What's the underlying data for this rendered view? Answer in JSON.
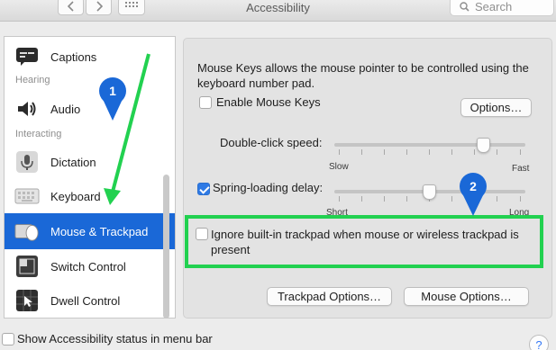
{
  "window": {
    "title": "Accessibility",
    "search_placeholder": "Search"
  },
  "sidebar": {
    "items": [
      {
        "label": "Captions",
        "icon": "captions-icon"
      },
      {
        "label": "Audio",
        "icon": "speaker-icon"
      },
      {
        "label": "Dictation",
        "icon": "microphone-icon"
      },
      {
        "label": "Keyboard",
        "icon": "keyboard-icon"
      },
      {
        "label": "Mouse & Trackpad",
        "icon": "mouse-trackpad-icon",
        "selected": true
      },
      {
        "label": "Switch Control",
        "icon": "switch-control-icon"
      },
      {
        "label": "Dwell Control",
        "icon": "dwell-control-icon"
      }
    ],
    "headings": [
      "Hearing",
      "Interacting"
    ]
  },
  "main": {
    "description": "Mouse Keys allows the mouse pointer to be controlled using the keyboard number pad.",
    "enable_mouse_keys": {
      "label": "Enable Mouse Keys",
      "checked": false
    },
    "options_button": "Options…",
    "double_click": {
      "label": "Double-click speed:",
      "min_label": "Slow",
      "max_label": "Fast",
      "value": 0.78
    },
    "spring_loading": {
      "label": "Spring-loading delay:",
      "checked": true,
      "min_label": "Short",
      "max_label": "Long",
      "value": 0.5
    },
    "ignore_trackpad": {
      "label": "Ignore built-in trackpad when mouse or wireless trackpad is present",
      "checked": false
    },
    "trackpad_options_button": "Trackpad Options…",
    "mouse_options_button": "Mouse Options…"
  },
  "footer": {
    "show_status": {
      "label": "Show Accessibility status in menu bar",
      "checked": false
    },
    "help": "?"
  },
  "annotations": {
    "badge1": "1",
    "badge2": "2",
    "badge_color": "#1a68d7",
    "highlight_color": "#22d150"
  }
}
